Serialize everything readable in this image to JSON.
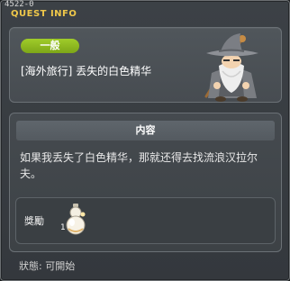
{
  "quest": {
    "id": "4522-0",
    "window_title": "QUEST INFO",
    "category": "一般",
    "name": "[海外旅行] 丢失的白色精华",
    "npc_icon": "old-wizard-npc-icon"
  },
  "content": {
    "header": "内容",
    "text": "如果我丢失了白色精华，那就还得去找流浪汉拉尔夫。"
  },
  "reward": {
    "label": "獎勵",
    "item_icon": "white-essence-potion-icon",
    "count": "1"
  },
  "status": {
    "text": "狀態:  可開始"
  },
  "colors": {
    "title": "#f0c84a",
    "badge": "#8fb81f",
    "window_bg": "#3c4146"
  }
}
